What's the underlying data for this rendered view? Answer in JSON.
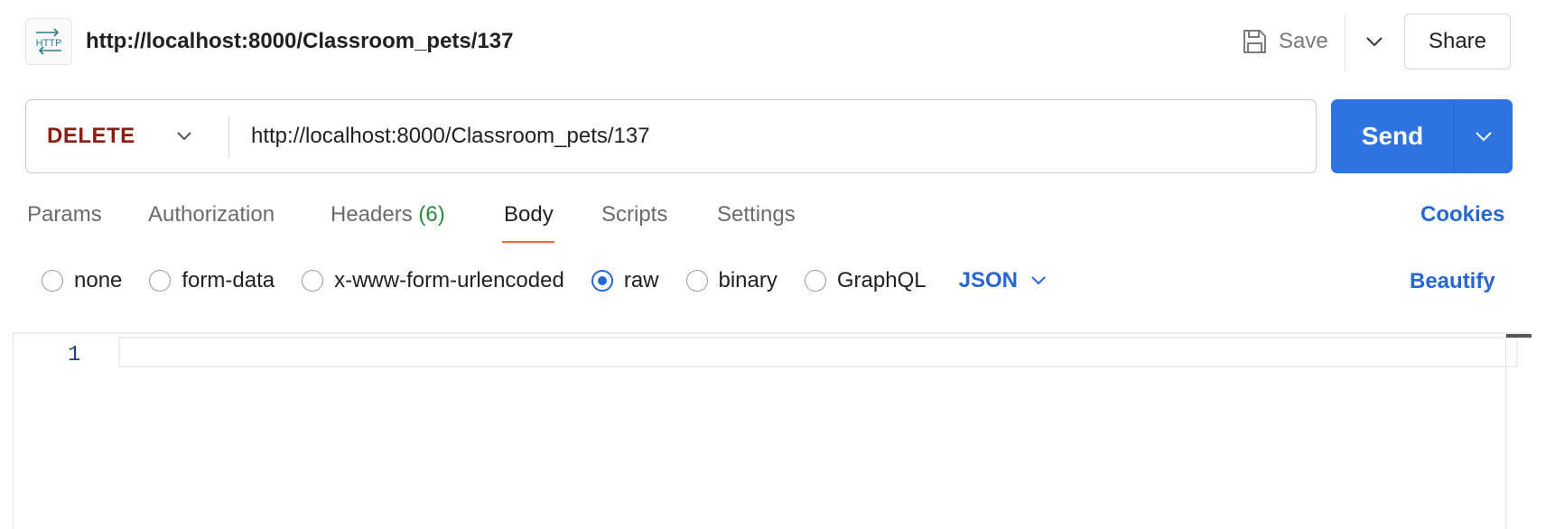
{
  "header": {
    "badge_icon": "http-icon",
    "title": "http://localhost:8000/Classroom_pets/137",
    "save_label": "Save",
    "share_label": "Share"
  },
  "request": {
    "method": "DELETE",
    "method_color": "#8e1a10",
    "url": "http://localhost:8000/Classroom_pets/137",
    "send_label": "Send",
    "send_color": "#2f73e0"
  },
  "tabs": [
    {
      "label": "Params"
    },
    {
      "label": "Authorization"
    },
    {
      "label": "Headers",
      "count": "(6)"
    },
    {
      "label": "Body",
      "active": true
    },
    {
      "label": "Scripts"
    },
    {
      "label": "Settings"
    }
  ],
  "cookies_label": "Cookies",
  "body_types": [
    {
      "label": "none",
      "checked": false
    },
    {
      "label": "form-data",
      "checked": false
    },
    {
      "label": "x-www-form-urlencoded",
      "checked": false
    },
    {
      "label": "raw",
      "checked": true
    },
    {
      "label": "binary",
      "checked": false
    },
    {
      "label": "GraphQL",
      "checked": false
    }
  ],
  "language": "JSON",
  "beautify_label": "Beautify",
  "editor": {
    "line_numbers": [
      "1"
    ],
    "content": ""
  },
  "colors": {
    "accent": "#2667d2",
    "active_tab_underline": "#f26b3a",
    "count": "#2a8a3e"
  }
}
